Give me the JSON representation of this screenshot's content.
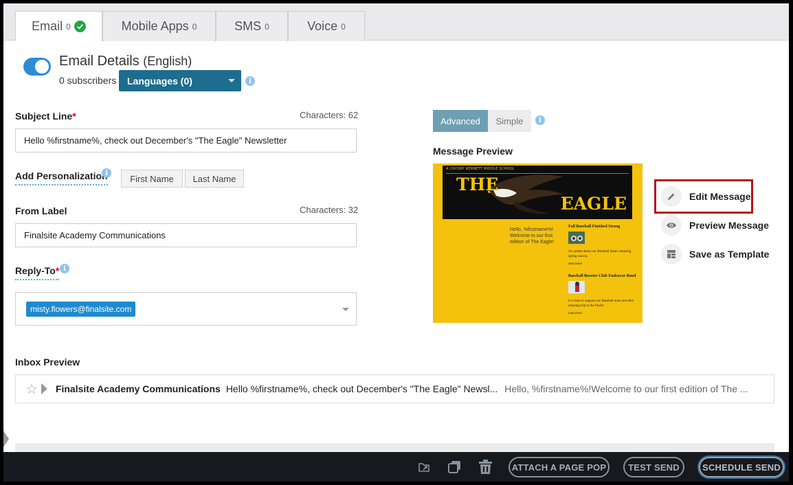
{
  "tabs": [
    {
      "label": "Email",
      "count": "0",
      "complete": true
    },
    {
      "label": "Mobile Apps",
      "count": "0"
    },
    {
      "label": "SMS",
      "count": "0"
    },
    {
      "label": "Voice",
      "count": "0"
    }
  ],
  "details": {
    "title": "Email Details",
    "language": "(English)",
    "subscribers": "0 subscribers",
    "languages_button": "Languages (0)",
    "enabled": true
  },
  "subject": {
    "label": "Subject Line",
    "required_mark": "*",
    "chars": "Characters: 62",
    "value": "Hello %firstname%, check out December's \"The Eagle\" Newsletter"
  },
  "personalization": {
    "label": "Add Personalization",
    "buttons": [
      "First Name",
      "Last Name"
    ]
  },
  "from_label": {
    "label": "From Label",
    "chars": "Characters: 32",
    "value": "Finalsite Academy Communications"
  },
  "reply_to": {
    "label": "Reply-To",
    "required_mark": "*",
    "chip": "misty.flowers@finalsite.com"
  },
  "editor_mode": {
    "options": [
      "Advanced",
      "Simple"
    ],
    "selected": "Advanced"
  },
  "message_preview": {
    "label": "Message Preview",
    "school": "A CROSBY KENNETT MIDDLE SCHOOL",
    "masthead_top": "THE",
    "masthead_bottom": "EAGLE",
    "greeting": "Hello, %firstname%! Welcome to our first edition of The Eagle!",
    "articles": [
      {
        "title": "Fall Baseball Finished Strong",
        "text": "An update about our Baseball team's amazing spring season.",
        "more": "read more"
      },
      {
        "title": "Baseball Booster Club Endeavor Bond",
        "text": "It is time to support our Baseball team and their amazing trip to the finals!",
        "more": "read more"
      }
    ]
  },
  "actions": {
    "edit": "Edit Message",
    "preview": "Preview Message",
    "template": "Save as Template"
  },
  "inbox": {
    "label": "Inbox Preview",
    "from": "Finalsite Academy Communications",
    "subject": "Hello %firstname%, check out December's \"The Eagle\" Newsl...",
    "snippet": "Hello, %firstname%!Welcome to our first edition of The ..."
  },
  "bottom_bar": {
    "attach": "ATTACH A PAGE POP",
    "test": "TEST SEND",
    "schedule": "SCHEDULE SEND"
  }
}
